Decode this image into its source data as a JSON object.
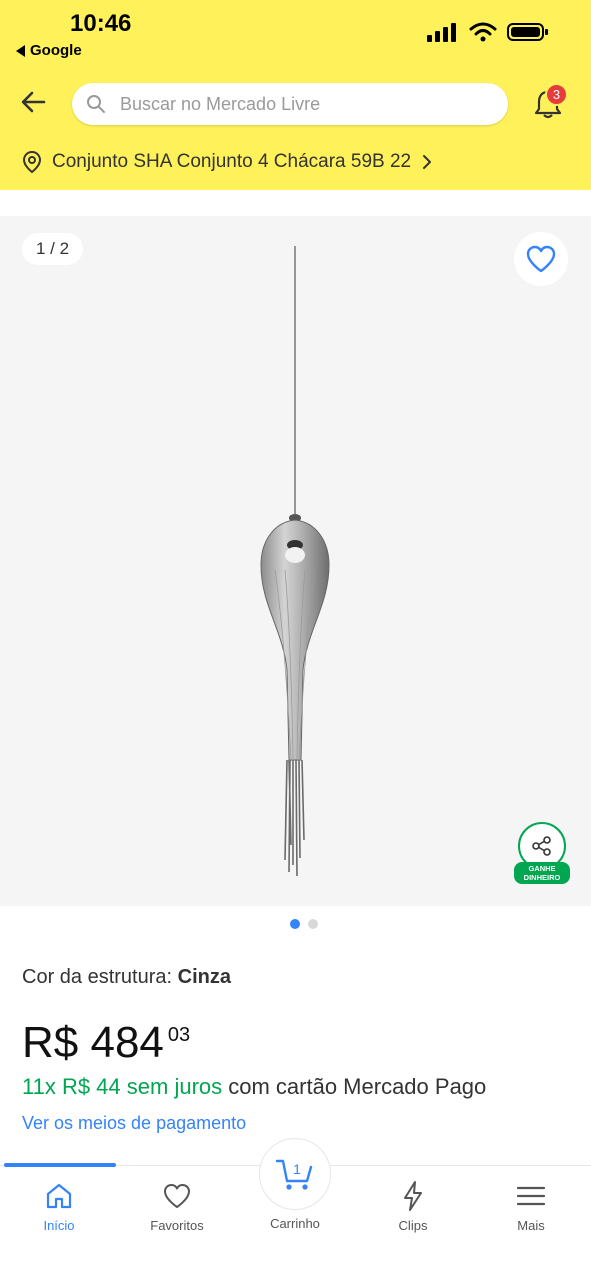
{
  "status_bar": {
    "time": "10:46",
    "back_app": "Google"
  },
  "header": {
    "search": {
      "placeholder": "Buscar no Mercado Livre"
    },
    "notifications_count": "3",
    "address": "Conjunto SHA Conjunto 4 Chácara 59B 22"
  },
  "gallery": {
    "counter": "1 / 2",
    "share_label_line1": "GANHE",
    "share_label_line2": "DINHEIRO",
    "dots": 2,
    "active_dot": 1
  },
  "product": {
    "color_label": "Cor da estrutura: ",
    "color_value": "Cinza",
    "price_main": "R$ 484",
    "price_cents": "03",
    "installments_green": "11x R$ 44 sem juros",
    "installments_rest": " com cartão Mercado Pago",
    "payment_link": "Ver os meios de pagamento"
  },
  "bottom_nav": {
    "items": [
      {
        "label": "Início",
        "icon": "home-icon"
      },
      {
        "label": "Favoritos",
        "icon": "heart-icon"
      },
      {
        "label": "Carrinho",
        "icon": "cart-icon"
      },
      {
        "label": "Clips",
        "icon": "clips-icon"
      },
      {
        "label": "Mais",
        "icon": "menu-icon"
      }
    ],
    "cart_count": "1"
  },
  "colors": {
    "header_yellow": "#fff159",
    "accent_blue": "#3483fa",
    "green": "#00a650",
    "badge_red": "#e83b3b"
  }
}
